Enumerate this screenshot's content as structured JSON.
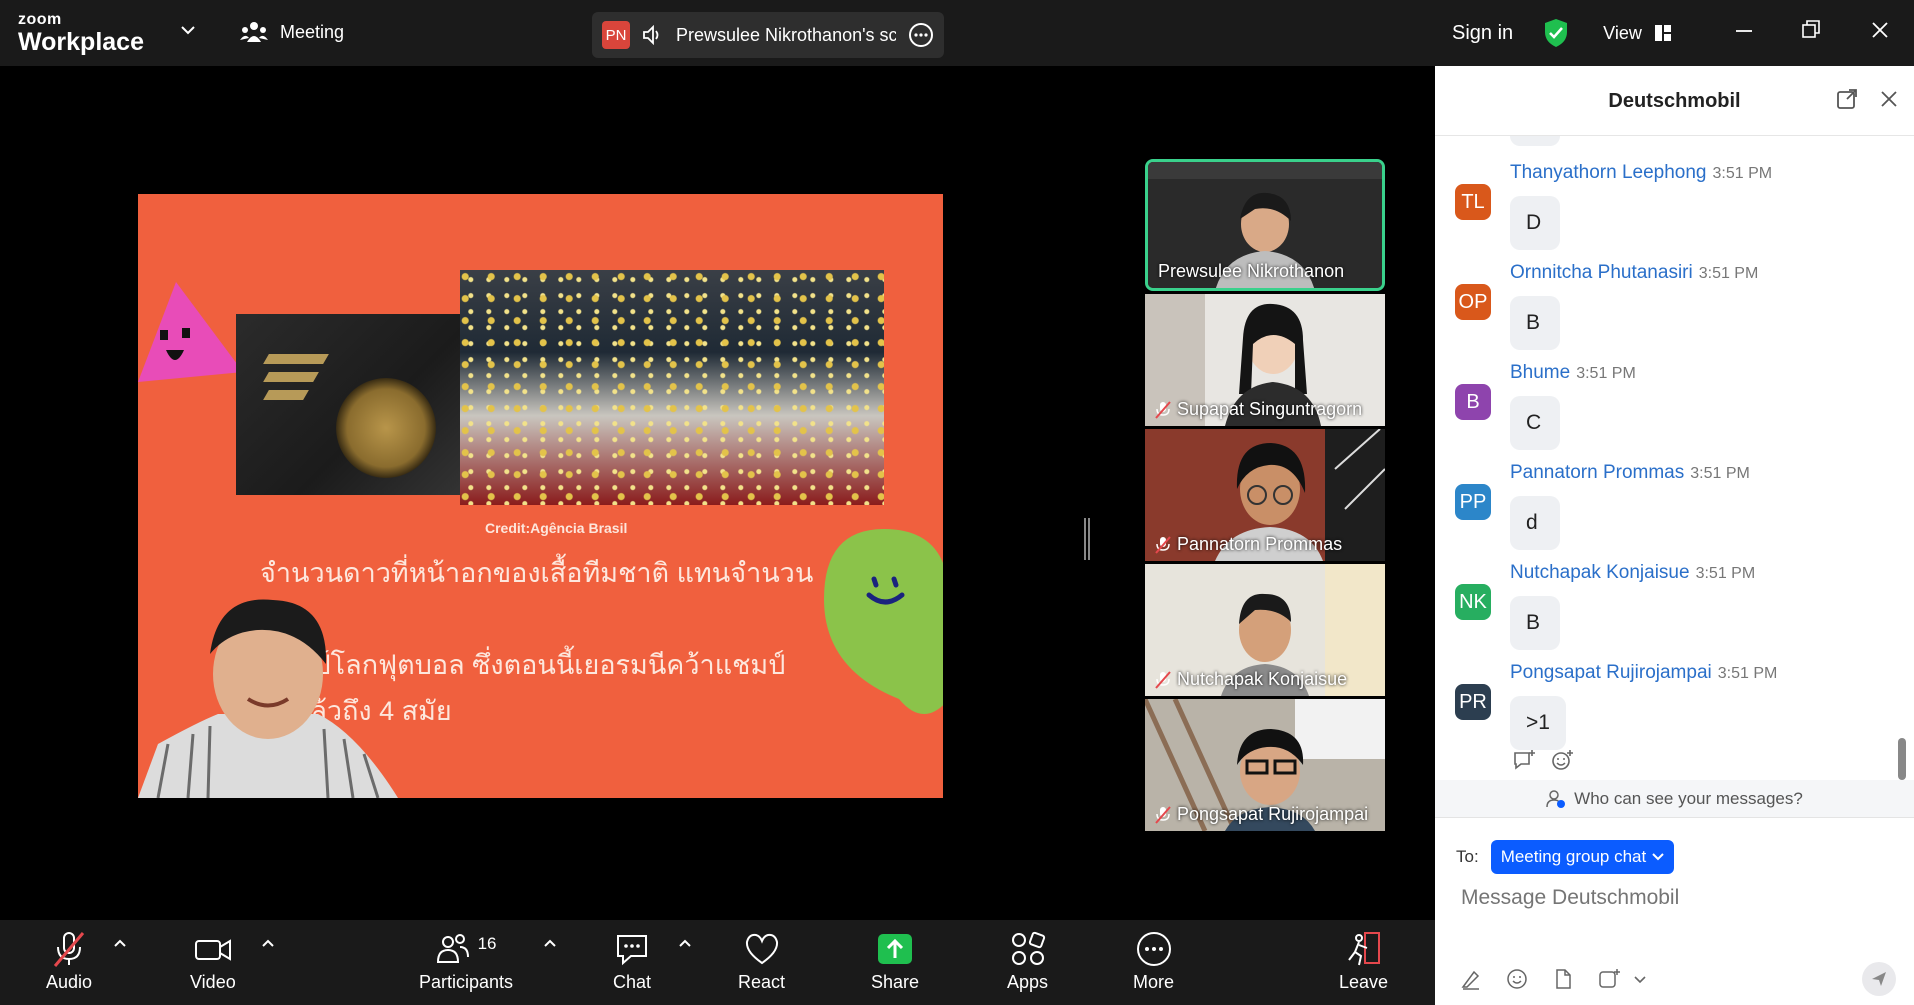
{
  "topbar": {
    "brand_top": "zoom",
    "brand_bottom": "Workplace",
    "meeting_label": "Meeting",
    "share_badge": "PN",
    "share_text": "Prewsulee Nikrothanon's scr",
    "sign_in": "Sign in",
    "view_label": "View"
  },
  "slide": {
    "credit": "Credit:Agência Brasil",
    "line1": "จำนวนดาวที่หน้าอกของเสื้อทีมชาติ แทนจำนวนการ",
    "line2": "แชมป์โลกฟุตบอล ซึ่งตอนนี้เยอรมนีคว้าแชมป์",
    "line3": "มาแล้วถึง 4 สมัย"
  },
  "gallery": [
    {
      "name": "Prewsulee Nikrothanon",
      "muted": false,
      "active": true
    },
    {
      "name": "Supapat Singuntragorn",
      "muted": true,
      "active": false
    },
    {
      "name": "Pannatorn Prommas",
      "muted": true,
      "active": false
    },
    {
      "name": "Nutchapak Konjaisue",
      "muted": true,
      "active": false
    },
    {
      "name": "Pongsapat Rujirojampai",
      "muted": true,
      "active": false
    }
  ],
  "toolbar": {
    "audio": "Audio",
    "video": "Video",
    "participants": "Participants",
    "participants_count": "16",
    "chat": "Chat",
    "react": "React",
    "share": "Share",
    "apps": "Apps",
    "more": "More",
    "leave": "Leave"
  },
  "chat": {
    "title": "Deutschmobil",
    "messages": [
      {
        "initials": "TL",
        "color": "#d9581b",
        "sender": "Thanyathorn Leephong",
        "time": "3:51 PM",
        "text": "D"
      },
      {
        "initials": "OP",
        "color": "#d9581b",
        "sender": "Ornnitcha Phutanasiri",
        "time": "3:51 PM",
        "text": "B"
      },
      {
        "initials": "B",
        "color": "#8e44ad",
        "sender": "Bhume",
        "time": "3:51 PM",
        "text": "C"
      },
      {
        "initials": "PP",
        "color": "#2c86c9",
        "sender": "Pannatorn Prommas",
        "time": "3:51 PM",
        "text": "d"
      },
      {
        "initials": "NK",
        "color": "#27ae60",
        "sender": "Nutchapak Konjaisue",
        "time": "3:51 PM",
        "text": "B"
      },
      {
        "initials": "PR",
        "color": "#2c3e50",
        "sender": "Pongsapat Rujirojampai",
        "time": "3:51 PM",
        "text": ">1"
      }
    ],
    "who_can_see": "Who can see your messages?",
    "to_label": "To:",
    "to_target": "Meeting group chat",
    "input_placeholder": "Message Deutschmobil"
  }
}
